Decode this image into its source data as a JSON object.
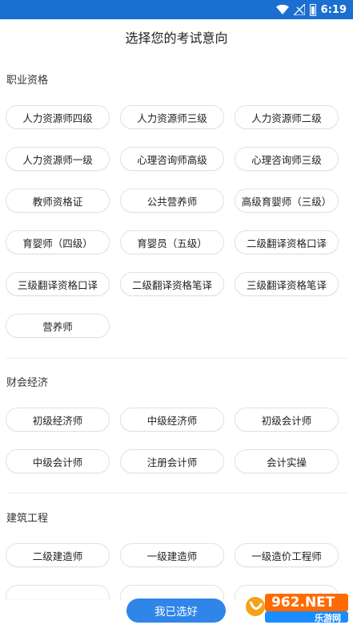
{
  "status_bar": {
    "time": "6:19"
  },
  "page_title": "选择您的考试意向",
  "sections": [
    {
      "title": "职业资格",
      "items": [
        "人力资源师四级",
        "人力资源师三级",
        "人力资源师二级",
        "人力资源师一级",
        "心理咨询师高级",
        "心理咨询师三级",
        "教师资格证",
        "公共营养师",
        "高级育婴师（三级）",
        "育婴师（四级）",
        "育婴员（五级）",
        "二级翻译资格口译",
        "三级翻译资格口译",
        "二级翻译资格笔译",
        "三级翻译资格笔译",
        "营养师"
      ]
    },
    {
      "title": "财会经济",
      "items": [
        "初级经济师",
        "中级经济师",
        "初级会计师",
        "中级会计师",
        "注册会计师",
        "会计实操"
      ]
    },
    {
      "title": "建筑工程",
      "items": [
        "二级建造师",
        "一级建造师",
        "一级造价工程师"
      ]
    }
  ],
  "confirm_button": "我已选好",
  "watermark": {
    "brand": "962.NET",
    "name": "乐游网"
  },
  "colors": {
    "status_bar": "#1b6fd1",
    "accent": "#2f86e8",
    "chip_border": "#e2e2e2"
  }
}
